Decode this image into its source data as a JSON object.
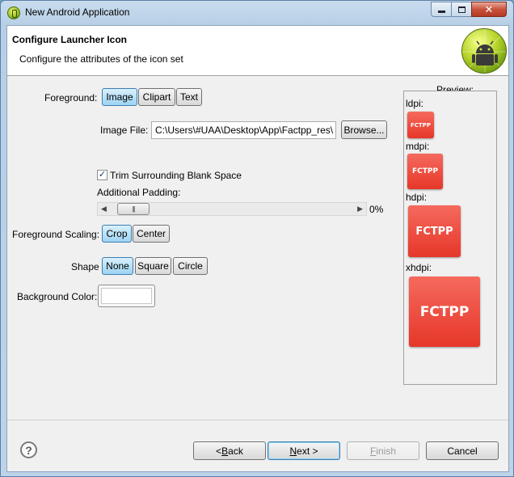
{
  "window": {
    "title": "New Android Application",
    "controls": {
      "minimize": "minimize",
      "maximize": "maximize",
      "close": "✕"
    }
  },
  "header": {
    "title": "Configure Launcher Icon",
    "description": "Configure the attributes of the icon set"
  },
  "foreground": {
    "label": "Foreground:",
    "options": [
      "Image",
      "Clipart",
      "Text"
    ],
    "selected": "Image"
  },
  "image_file": {
    "label": "Image File:",
    "value": "C:\\Users\\#UAA\\Desktop\\App\\Factpp_res\\",
    "browse_label": "Browse..."
  },
  "trim": {
    "label": "Trim Surrounding Blank Space",
    "checked": true
  },
  "padding": {
    "label": "Additional Padding:",
    "value_text": "0%",
    "value": 0
  },
  "scaling": {
    "label": "Foreground Scaling:",
    "options": [
      "Crop",
      "Center"
    ],
    "selected": "Crop"
  },
  "shape": {
    "label": "Shape",
    "options": [
      "None",
      "Square",
      "Circle"
    ],
    "selected": "None"
  },
  "background": {
    "label": "Background Color:",
    "color": "#ffffff"
  },
  "preview": {
    "label": "Preview:",
    "densities": [
      {
        "name": "ldpi:",
        "text": "FCTPP"
      },
      {
        "name": "mdpi:",
        "text": "FCTPP"
      },
      {
        "name": "hdpi:",
        "text": "FCTPP"
      },
      {
        "name": "xhdpi:",
        "text": "FCTPP"
      }
    ],
    "icon_color": "#e8392c"
  },
  "footer": {
    "help": "?",
    "back_prefix": "< ",
    "back_key": "B",
    "back_rest": "ack",
    "next_key": "N",
    "next_rest": "ext >",
    "finish_key": "F",
    "finish_rest": "inish",
    "cancel_label": "Cancel"
  }
}
